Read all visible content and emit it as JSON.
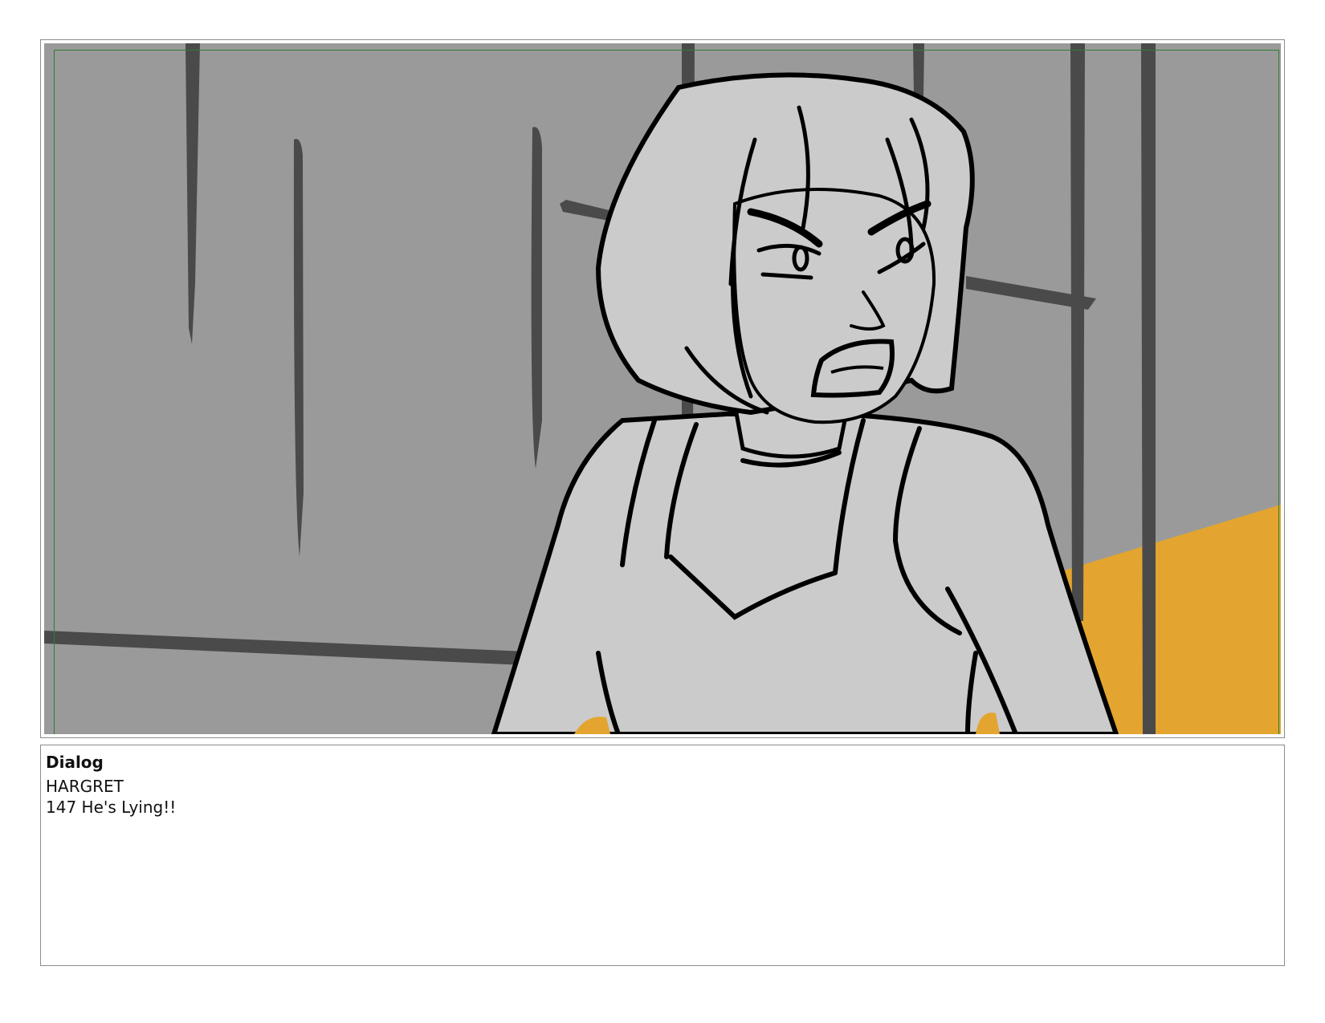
{
  "panel": {
    "palette": {
      "background": "#9a9a9a",
      "wall_stroke": "#4a4a4a",
      "skin_hair": "#cbcbcb",
      "ink": "#000000",
      "accent_orange": "#e3a52f",
      "safe_frame": "#2e7d32"
    }
  },
  "dialog": {
    "heading": "Dialog",
    "speaker": "HARGRET",
    "line": "147 He's Lying!!"
  }
}
